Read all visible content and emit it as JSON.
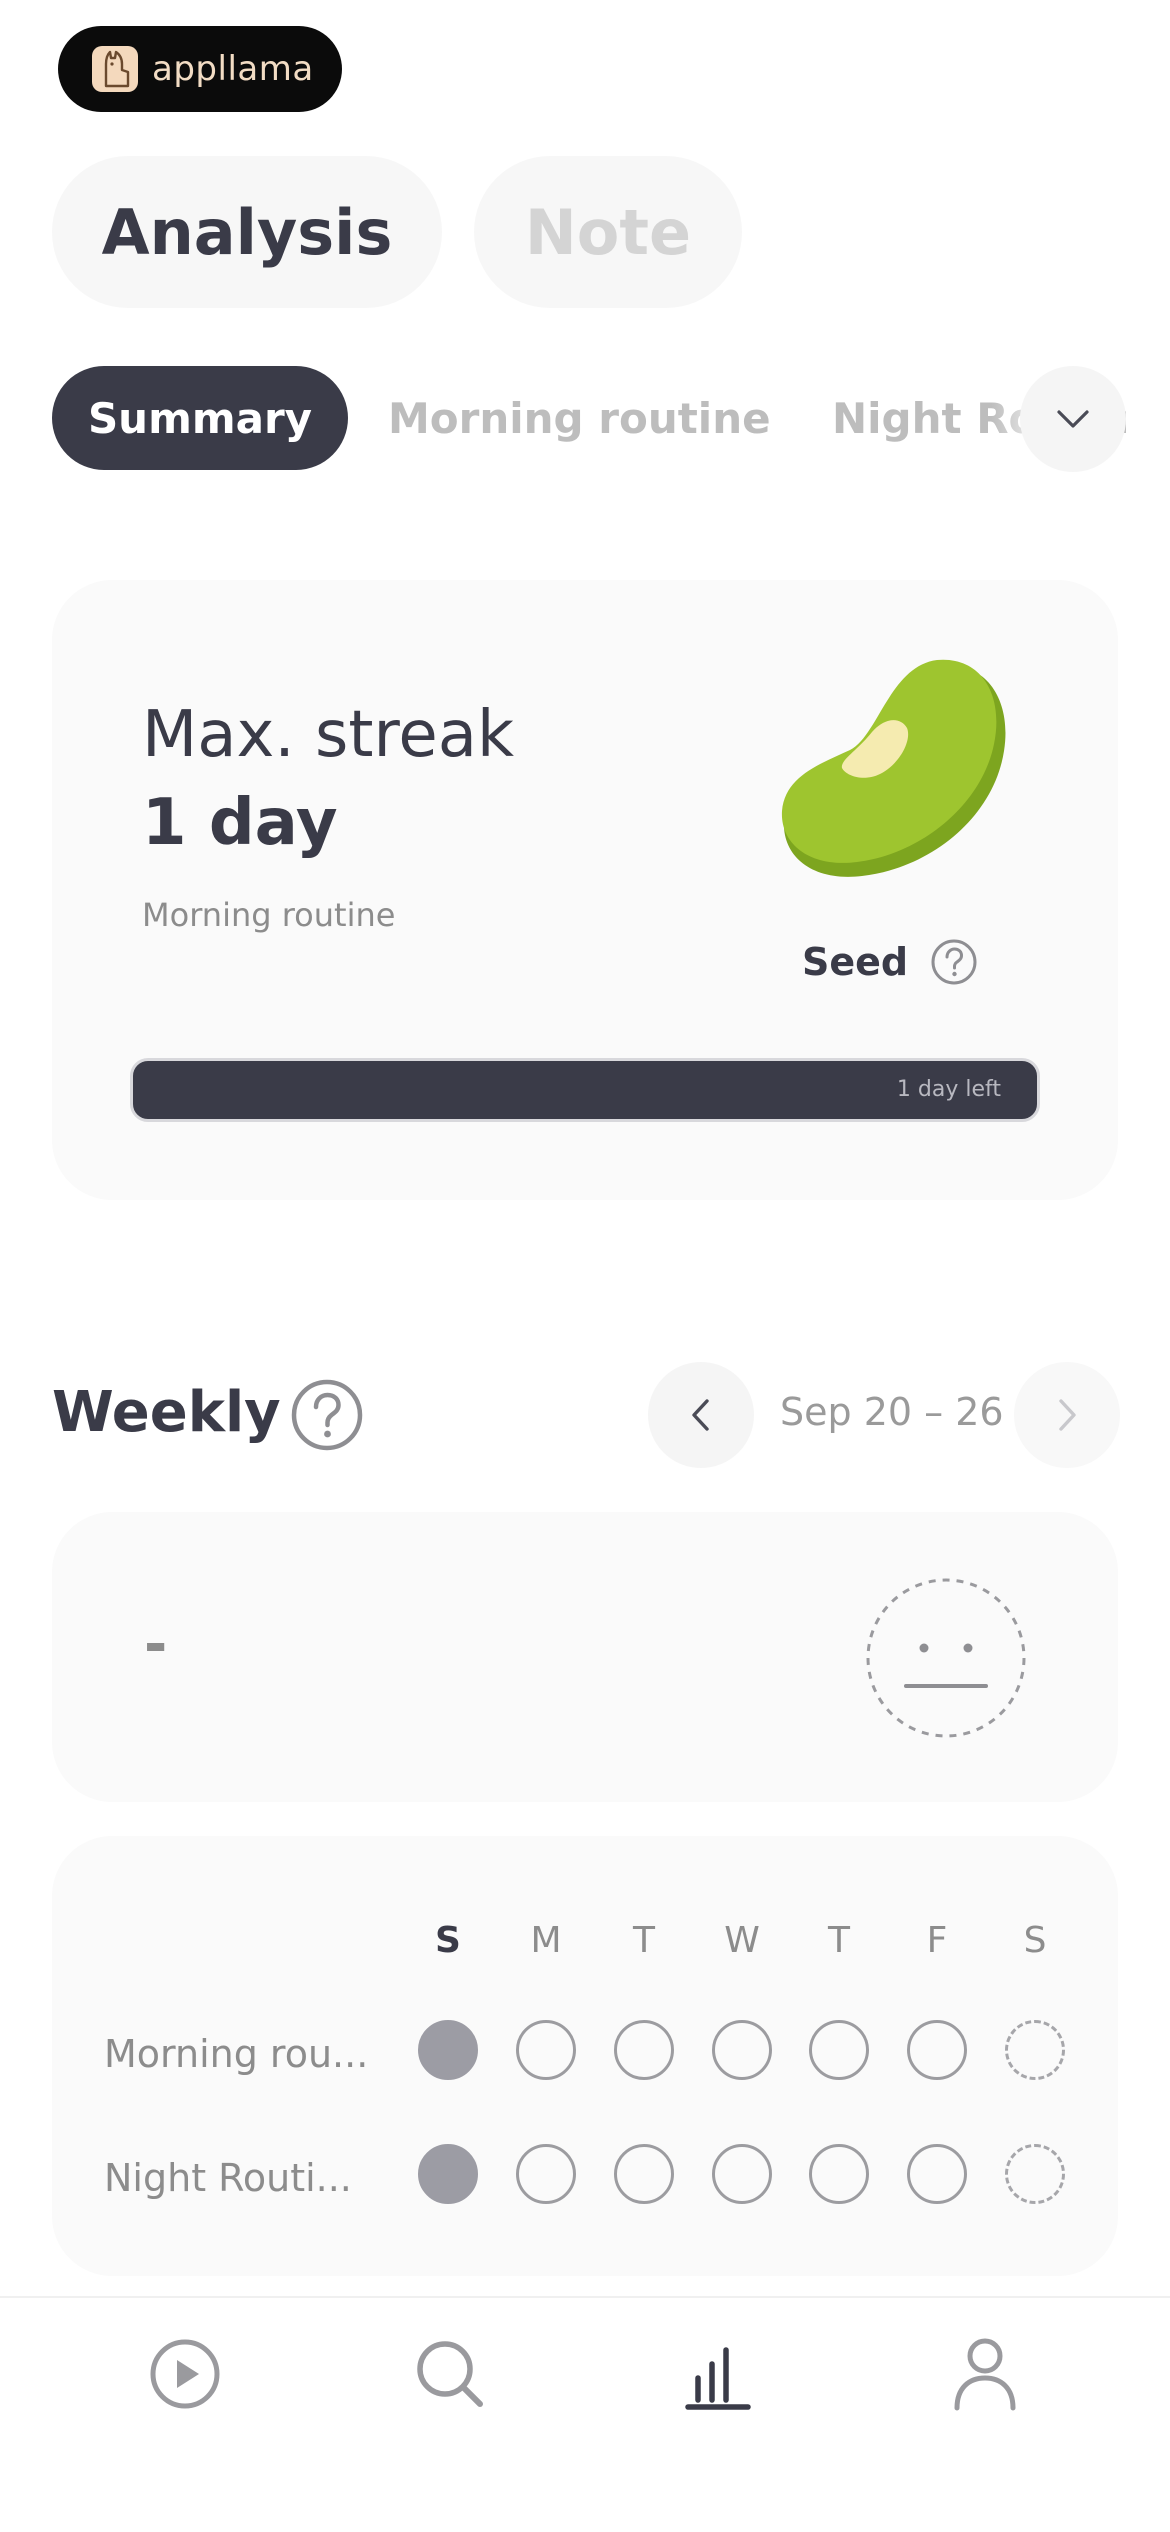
{
  "logo": {
    "text": "appllama"
  },
  "top_tabs": [
    {
      "label": "Analysis",
      "active": true
    },
    {
      "label": "Note",
      "active": false
    }
  ],
  "sub_tabs": [
    {
      "label": "Summary",
      "active": true
    },
    {
      "label": "Morning routine",
      "active": false
    },
    {
      "label": "Night Routine",
      "active": false
    }
  ],
  "streak_card": {
    "title": "Max. streak",
    "value": "1 day",
    "routine": "Morning routine",
    "stage_label": "Seed",
    "stage_icon": "question-icon",
    "progress_text": "1 day left",
    "colors": {
      "seed_green": "#9ec52f",
      "seed_shadow": "#7da51f",
      "seed_highlight": "#f5ebb0",
      "bar": "#3a3b48"
    }
  },
  "weekly": {
    "title": "Weekly",
    "help_icon": "question-icon",
    "date_range": "Sep 20 – 26",
    "mood_value": "-",
    "mood_icon": "neutral-face-icon",
    "days": [
      "S",
      "M",
      "T",
      "W",
      "T",
      "F",
      "S"
    ],
    "rows": [
      {
        "label": "Morning rou...",
        "states": [
          "done",
          "empty",
          "empty",
          "empty",
          "empty",
          "empty",
          "future"
        ]
      },
      {
        "label": "Night Routi...",
        "states": [
          "done",
          "empty",
          "empty",
          "empty",
          "empty",
          "empty",
          "future"
        ]
      }
    ]
  },
  "bottom_nav": [
    {
      "icon": "play-icon",
      "active": false
    },
    {
      "icon": "search-icon",
      "active": false
    },
    {
      "icon": "bar-chart-icon",
      "active": true
    },
    {
      "icon": "profile-icon",
      "active": false
    }
  ],
  "colors": {
    "accent": "#3a3b48",
    "muted": "#8c8c8c",
    "card_bg": "#fafafa"
  }
}
